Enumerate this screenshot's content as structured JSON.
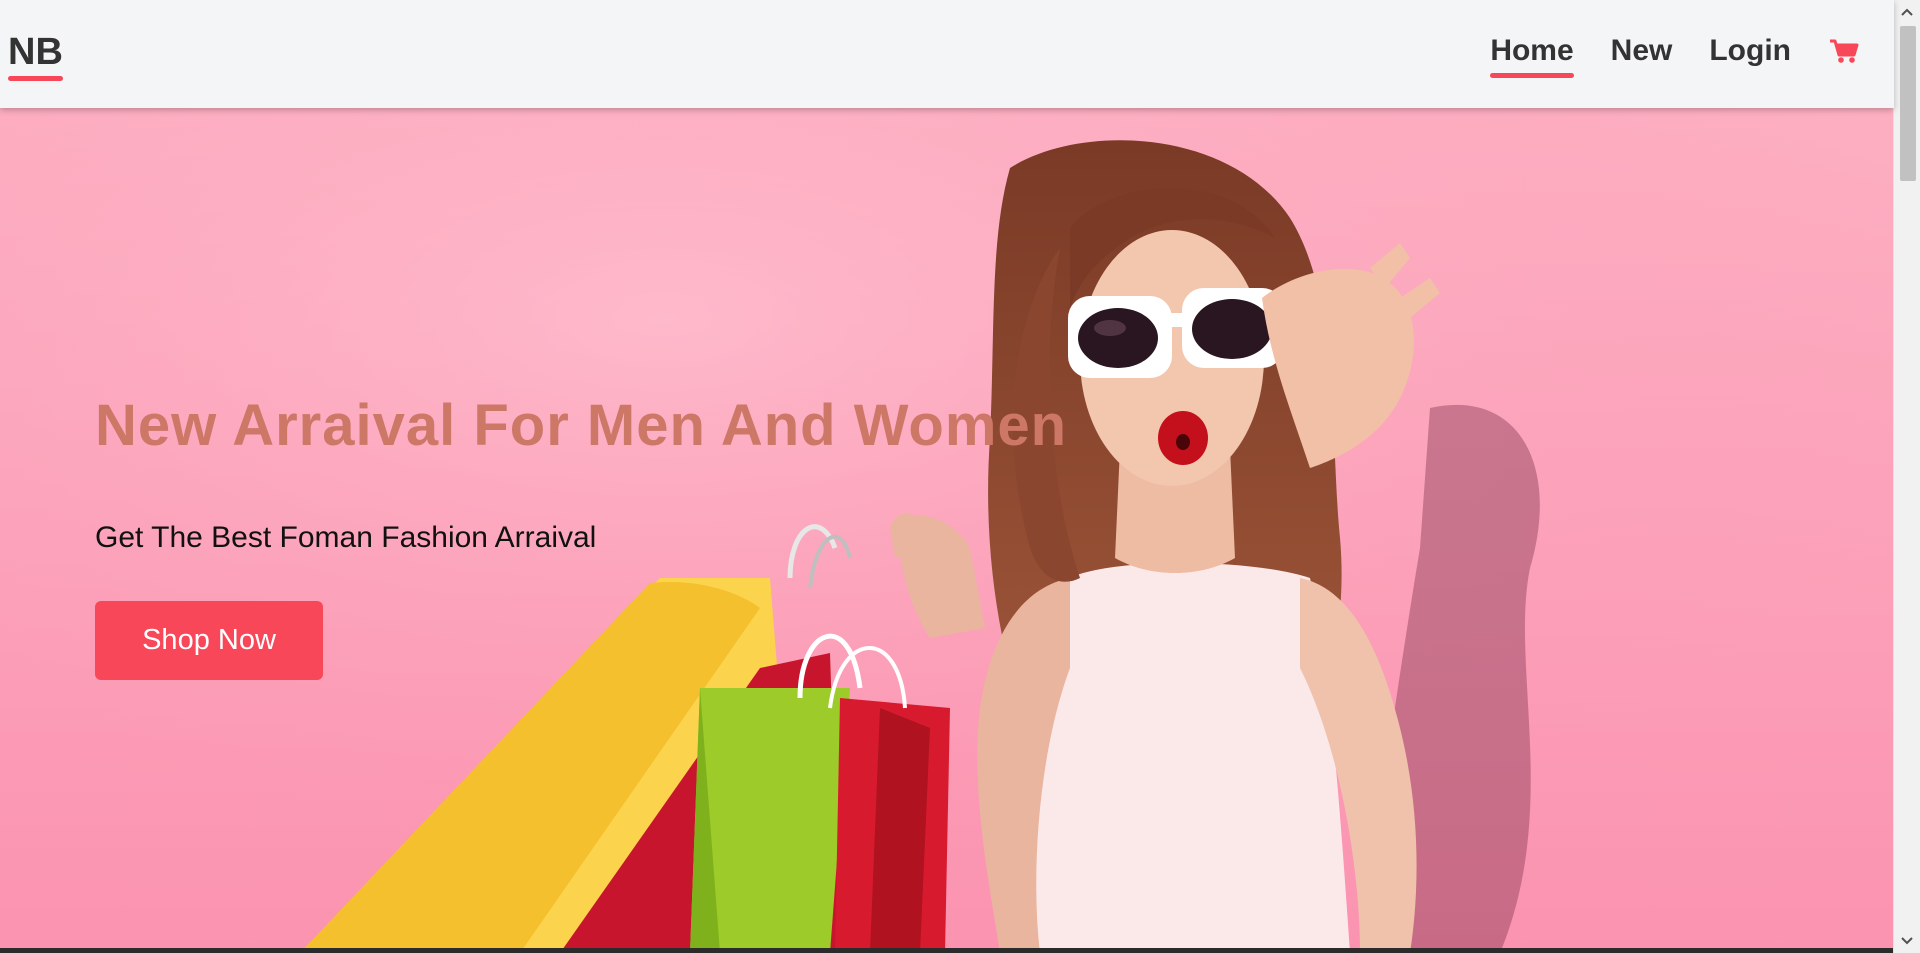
{
  "navbar": {
    "brand": "NB",
    "links": [
      {
        "label": "Home",
        "active": true
      },
      {
        "label": "New",
        "active": false
      },
      {
        "label": "Login",
        "active": false
      }
    ],
    "cart_icon": "shopping-cart-icon"
  },
  "hero": {
    "title": "New Arraival For Men And Women",
    "subtitle": "Get The Best Foman Fashion Arraival",
    "cta_label": "Shop Now"
  },
  "colors": {
    "accent": "#f74758",
    "title": "#cd7767",
    "navbar_bg": "#f4f5f7",
    "hero_bg": "#fca3bb"
  }
}
